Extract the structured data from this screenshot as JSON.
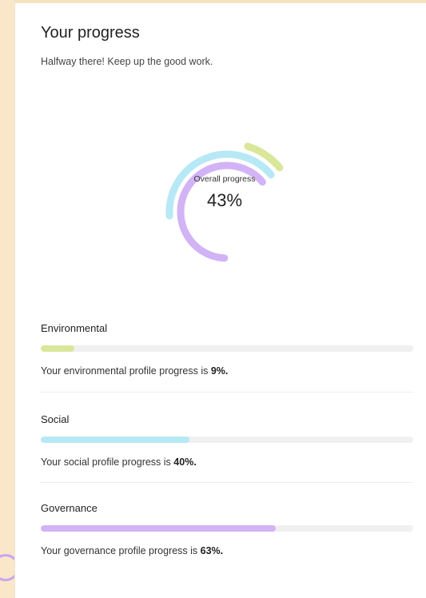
{
  "card": {
    "title": "Your progress",
    "subtitle": "Halfway there! Keep up the good work."
  },
  "overall": {
    "label": "Overall progress",
    "value_text": "43%",
    "rings": [
      {
        "name": "Governance",
        "percent": 63,
        "color": "#d2b3f5"
      },
      {
        "name": "Social",
        "percent": 40,
        "color": "#b7e8f5"
      },
      {
        "name": "Environmental",
        "percent": 9,
        "color": "#d9e79a"
      }
    ]
  },
  "sections": [
    {
      "title": "Environmental",
      "percent": 9,
      "color": "#d9e79a",
      "desc_prefix": "Your environmental profile progress is ",
      "desc_value": "9%."
    },
    {
      "title": "Social",
      "percent": 40,
      "color": "#b7e8f5",
      "desc_prefix": "Your social profile progress is ",
      "desc_value": "40%."
    },
    {
      "title": "Governance",
      "percent": 63,
      "color": "#d2b3f5",
      "desc_prefix": "Your governance profile progress is ",
      "desc_value": "63%."
    }
  ]
}
